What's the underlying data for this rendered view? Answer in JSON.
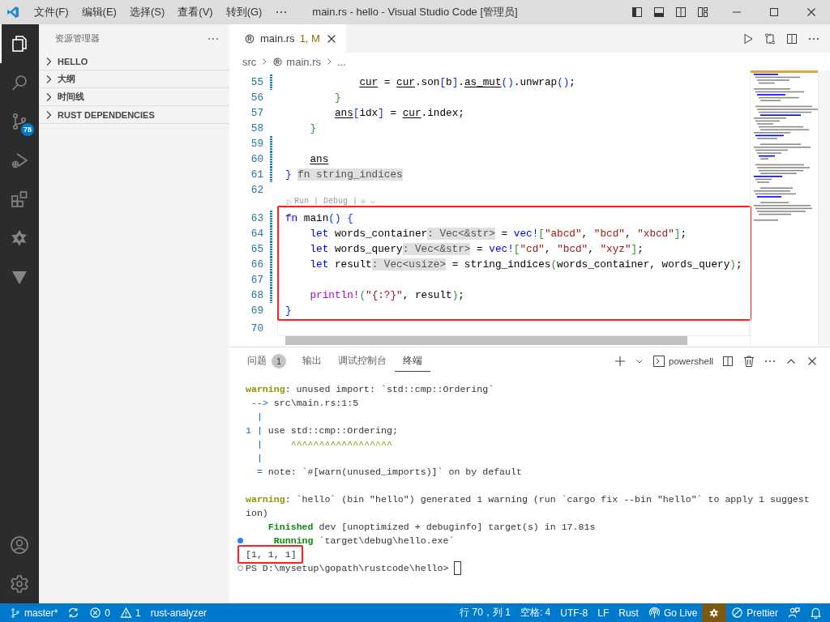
{
  "title_bar": {
    "menus": [
      "文件(F)",
      "编辑(E)",
      "选择(S)",
      "查看(V)",
      "转到(G)"
    ],
    "title": "main.rs - hello - Visual Studio Code [管理员]"
  },
  "activity_bar": {
    "items": [
      {
        "kind": "files",
        "selected": true
      },
      {
        "kind": "search",
        "selected": false
      },
      {
        "kind": "source-control",
        "selected": false,
        "badge": "78"
      },
      {
        "kind": "run-debug",
        "selected": false
      },
      {
        "kind": "extensions",
        "selected": false
      },
      {
        "kind": "knot",
        "selected": false
      },
      {
        "kind": "triangle",
        "selected": false
      }
    ],
    "bottom": [
      {
        "kind": "account"
      },
      {
        "kind": "settings"
      }
    ]
  },
  "sidebar": {
    "title": "资源管理器",
    "sections": [
      {
        "label": "HELLO",
        "expanded": false
      },
      {
        "label": "大纲",
        "expanded": false
      },
      {
        "label": "时间线",
        "expanded": false
      },
      {
        "label": "RUST DEPENDENCIES",
        "expanded": false
      }
    ]
  },
  "editor": {
    "tab": {
      "file": "main.rs",
      "status": "1, M",
      "selected": true
    },
    "breadcrumb": [
      "src",
      "main.rs",
      "..."
    ],
    "lines": [
      {
        "kind": "code",
        "number": "55",
        "modified": true,
        "segments": [
          {
            "text": "            cur",
            "kind": "var"
          },
          {
            "text": " = "
          },
          {
            "text": "cur",
            "kind": "var"
          },
          {
            "text": ".son"
          },
          {
            "text": "[",
            "kind": "b1"
          },
          {
            "text": "b"
          },
          {
            "text": "]",
            "kind": "b1"
          },
          {
            "text": "."
          },
          {
            "text": "as_mut",
            "kind": "var"
          },
          {
            "text": "()",
            "kind": "b1"
          },
          {
            "text": ".unwrap"
          },
          {
            "text": "()",
            "kind": "b1"
          },
          {
            "text": ";"
          }
        ]
      },
      {
        "kind": "code",
        "number": "56",
        "modified": false,
        "segments": [
          {
            "text": "        }",
            "kind": "b2"
          }
        ]
      },
      {
        "kind": "code",
        "number": "57",
        "modified": false,
        "segments": [
          {
            "text": "        ans",
            "kind": "var"
          },
          {
            "text": "[",
            "kind": "b1"
          },
          {
            "text": "idx"
          },
          {
            "text": "]",
            "kind": "b1"
          },
          {
            "text": " = "
          },
          {
            "text": "cur",
            "kind": "var"
          },
          {
            "text": ".index;"
          }
        ]
      },
      {
        "kind": "code",
        "number": "58",
        "modified": false,
        "segments": [
          {
            "text": "    }",
            "kind": "b2"
          }
        ]
      },
      {
        "kind": "code",
        "number": "59",
        "modified": true
      },
      {
        "kind": "code",
        "number": "60",
        "modified": true,
        "segments": [
          {
            "text": "    ans",
            "kind": "var"
          }
        ]
      },
      {
        "kind": "code",
        "number": "61",
        "modified": true,
        "segments": [
          {
            "text": "} ",
            "kind": "b1"
          },
          {
            "text": "fn string_indices",
            "kind": "hint"
          }
        ]
      },
      {
        "kind": "code",
        "number": "62",
        "modified": false
      },
      {
        "kind": "lens",
        "text": "Run | Debug |"
      },
      {
        "kind": "code",
        "number": "63",
        "modified": true,
        "boxed": true,
        "segments": [
          {
            "text": "fn",
            "kind": "kw"
          },
          {
            "text": " main"
          },
          {
            "text": "() {",
            "kind": "b1"
          }
        ]
      },
      {
        "kind": "code",
        "number": "64",
        "modified": true,
        "boxed": true,
        "segments": [
          {
            "text": "    let",
            "kind": "kw"
          },
          {
            "text": " words_container"
          },
          {
            "text": ": Vec<&str>",
            "kind": "hint"
          },
          {
            "text": " = "
          },
          {
            "text": "vec!",
            "kind": "kw"
          },
          {
            "text": "[",
            "kind": "b2"
          },
          {
            "text": "\"abcd\"",
            "kind": "str"
          },
          {
            "text": ", "
          },
          {
            "text": "\"bcd\"",
            "kind": "str"
          },
          {
            "text": ", "
          },
          {
            "text": "\"xbcd\"",
            "kind": "str"
          },
          {
            "text": "]",
            "kind": "b2"
          },
          {
            "text": ";"
          }
        ]
      },
      {
        "kind": "code",
        "number": "65",
        "modified": true,
        "boxed": true,
        "segments": [
          {
            "text": "    let",
            "kind": "kw"
          },
          {
            "text": " words_query"
          },
          {
            "text": ": Vec<&str>",
            "kind": "hint"
          },
          {
            "text": " = "
          },
          {
            "text": "vec!",
            "kind": "kw"
          },
          {
            "text": "[",
            "kind": "b2"
          },
          {
            "text": "\"cd\"",
            "kind": "str"
          },
          {
            "text": ", "
          },
          {
            "text": "\"bcd\"",
            "kind": "str"
          },
          {
            "text": ", "
          },
          {
            "text": "\"xyz\"",
            "kind": "str"
          },
          {
            "text": "]",
            "kind": "b2"
          },
          {
            "text": ";"
          }
        ]
      },
      {
        "kind": "code",
        "number": "66",
        "modified": true,
        "boxed": true,
        "segments": [
          {
            "text": "    let",
            "kind": "kw"
          },
          {
            "text": " result"
          },
          {
            "text": ": Vec<usize>",
            "kind": "hint"
          },
          {
            "text": " = string_indices"
          },
          {
            "text": "(",
            "kind": "b2"
          },
          {
            "text": "words_container, words_query"
          },
          {
            "text": ")",
            "kind": "b2"
          },
          {
            "text": ";"
          }
        ]
      },
      {
        "kind": "code",
        "number": "67",
        "modified": true,
        "boxed": true
      },
      {
        "kind": "code",
        "number": "68",
        "modified": true,
        "boxed": true,
        "segments": [
          {
            "text": "    println!",
            "kind": "macro"
          },
          {
            "text": "(",
            "kind": "b2"
          },
          {
            "text": "\"{:?}\"",
            "kind": "str"
          },
          {
            "text": ", result"
          },
          {
            "text": ")",
            "kind": "b2"
          },
          {
            "text": ";"
          }
        ]
      },
      {
        "kind": "code",
        "number": "69",
        "modified": false,
        "boxed": true,
        "segments": [
          {
            "text": "}",
            "kind": "b1"
          }
        ]
      },
      {
        "kind": "code",
        "number": "70",
        "modified": false,
        "current": true
      }
    ]
  },
  "panel": {
    "tabs": [
      {
        "label": "问题",
        "badge": "1",
        "selected": false
      },
      {
        "label": "输出",
        "selected": false
      },
      {
        "label": "调试控制台",
        "selected": false
      },
      {
        "label": "终端",
        "selected": true
      }
    ],
    "shell": "powershell",
    "lines": [
      {
        "kind": "text",
        "segments": [
          {
            "text": "warning",
            "kind": "warn"
          },
          {
            "text": ": unused import: `std::cmp::Ordering`"
          }
        ]
      },
      {
        "kind": "text",
        "segments": [
          {
            "text": " -->",
            "kind": "arrow"
          },
          {
            "text": " src\\main.rs:1:5"
          }
        ]
      },
      {
        "kind": "text",
        "segments": [
          {
            "text": "  |",
            "kind": "arrow"
          }
        ]
      },
      {
        "kind": "text",
        "segments": [
          {
            "text": "1 |",
            "kind": "arrow"
          },
          {
            "text": " use std::cmp::Ordering;"
          }
        ]
      },
      {
        "kind": "text",
        "segments": [
          {
            "text": "  |",
            "kind": "arrow"
          },
          {
            "text": "     ^^^^^^^^^^^^^^^^^^",
            "kind": "caret"
          }
        ]
      },
      {
        "kind": "text",
        "segments": [
          {
            "text": "  |",
            "kind": "arrow"
          }
        ]
      },
      {
        "kind": "text",
        "segments": [
          {
            "text": "  =",
            "kind": "arrow"
          },
          {
            "text": " note: `#[warn(unused_imports)]` on by default"
          }
        ]
      },
      {
        "kind": "blank"
      },
      {
        "kind": "text",
        "segments": [
          {
            "text": "warning",
            "kind": "warn"
          },
          {
            "text": ": `hello` (bin \"hello\") generated 1 warning (run `cargo fix --bin \"hello\"` to apply 1 suggest"
          }
        ]
      },
      {
        "kind": "text",
        "segments": [
          {
            "text": "ion)"
          }
        ]
      },
      {
        "kind": "text",
        "segments": [
          {
            "text": "    Finished",
            "kind": "ok"
          },
          {
            "text": " dev [unoptimized + debuginfo] target(s) in 17.81s"
          }
        ]
      },
      {
        "kind": "text",
        "command_done": true,
        "segments": [
          {
            "text": "     Running",
            "kind": "ok"
          },
          {
            "text": " `target\\debug\\hello.exe`"
          }
        ]
      },
      {
        "kind": "text",
        "boxed": true,
        "segments": [
          {
            "text": "[1, 1, 1]"
          }
        ]
      },
      {
        "kind": "text",
        "command_done": false,
        "cursor": true,
        "segments": [
          {
            "text": "PS D:\\mysetup\\gopath\\rustcode\\hello>"
          }
        ]
      }
    ]
  },
  "status_bar": {
    "left": [
      {
        "kind": "branch",
        "text": "master*"
      },
      {
        "kind": "sync"
      },
      {
        "kind": "errors",
        "text": "0"
      },
      {
        "kind": "warnings",
        "text": "1"
      },
      {
        "kind": "text",
        "text": "rust-analyzer"
      }
    ],
    "right": [
      {
        "kind": "text",
        "text": "行 70，列 1"
      },
      {
        "kind": "text",
        "text": "空格: 4"
      },
      {
        "kind": "text",
        "text": "UTF-8"
      },
      {
        "kind": "text",
        "text": "LF"
      },
      {
        "kind": "text",
        "text": "Rust"
      },
      {
        "kind": "golive",
        "text": "Go Live"
      },
      {
        "kind": "knot",
        "highlighted": true
      },
      {
        "kind": "prettier",
        "text": "Prettier"
      },
      {
        "kind": "feedback"
      },
      {
        "kind": "bell"
      }
    ]
  }
}
